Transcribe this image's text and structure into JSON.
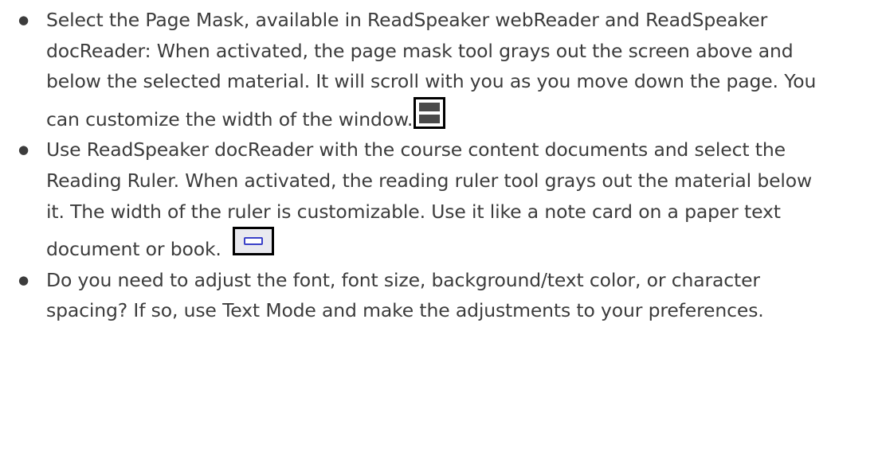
{
  "bullets": [
    {
      "text": "Select the Page Mask, available in ReadSpeaker webReader and ReadSpeaker docReader:   When activated, the page mask tool grays out the screen above and below the selected material.  It will scroll with you as you move down the page. You can customize the width of the window.",
      "icon": "page-mask-icon"
    },
    {
      "text": "Use ReadSpeaker docReader with the course content documents and select the Reading Ruler. When activated, the reading ruler tool grays out the material below it.  The width of the ruler is customizable. Use it like a note card on a paper text document or book.",
      "icon": "reading-ruler-icon"
    },
    {
      "text": "Do you need to adjust the font, font size, background/text color, or character spacing? If so, use Text Mode and make the adjustments to your preferences.",
      "icon": ""
    }
  ],
  "bullet_glyph": "●",
  "colors": {
    "text": "#3c3c3c",
    "icon_border": "#000000",
    "icon_fill_dark": "#4a4a4a",
    "ruler_bg": "#e9e9ef",
    "ruler_bar": "#3a40c8"
  }
}
